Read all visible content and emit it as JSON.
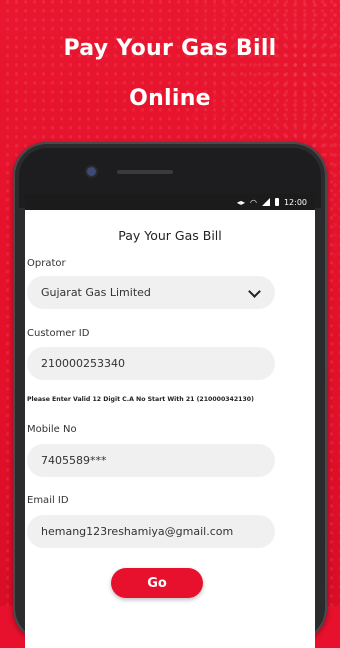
{
  "promo": {
    "line1": "Pay Your Gas Bill",
    "line2": "Online",
    "background_color": "#e8112d"
  },
  "status_bar": {
    "time": "12:00",
    "icons": [
      "vibrate-icon",
      "wifi-icon",
      "signal-icon",
      "battery-icon"
    ]
  },
  "screen": {
    "title": "Pay Your Gas Bill",
    "operator": {
      "label": "Oprator",
      "selected": "Gujarat Gas Limited"
    },
    "customer_id": {
      "label": "Customer ID",
      "value": "210000253340",
      "hint": "Please Enter Valid 12 Digit C.A No Start With  21 (210000342130)"
    },
    "mobile": {
      "label": "Mobile No",
      "value": "7405589***"
    },
    "email": {
      "label": "Email ID",
      "value": "hemang123reshamiya@gmail.com"
    },
    "go_label": "Go",
    "accent_color": "#e8112d"
  }
}
